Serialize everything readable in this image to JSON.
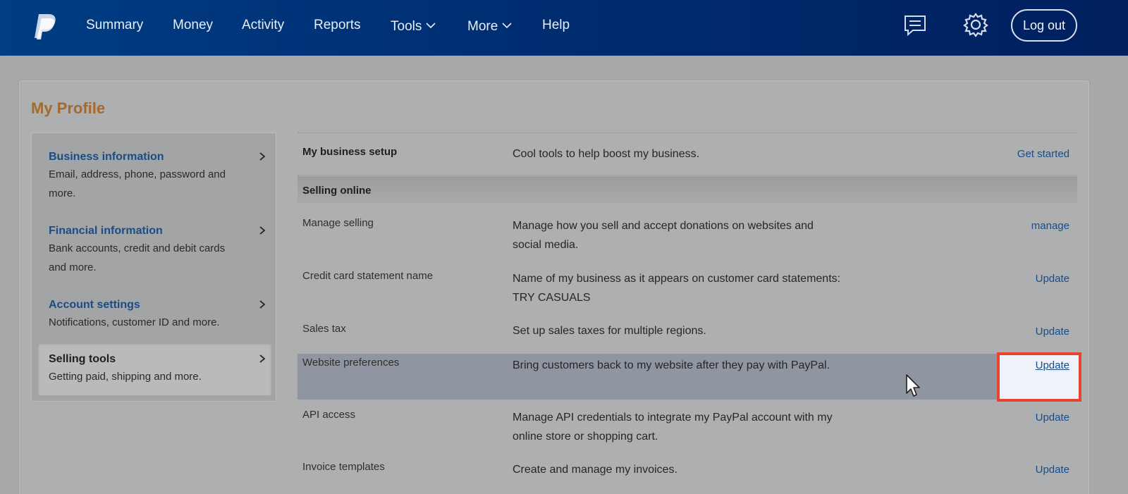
{
  "nav": {
    "items": [
      "Summary",
      "Money",
      "Activity",
      "Reports",
      "Tools",
      "More",
      "Help"
    ],
    "logout_label": "Log out"
  },
  "page": {
    "title": "My Profile"
  },
  "sidebar": {
    "items": [
      {
        "title": "Business information",
        "desc": "Email, address, phone, password and more."
      },
      {
        "title": "Financial information",
        "desc": "Bank accounts, credit and debit cards and more."
      },
      {
        "title": "Account settings",
        "desc": "Notifications, customer ID and more."
      },
      {
        "title": "Selling tools",
        "desc": "Getting paid, shipping and more."
      }
    ]
  },
  "main": {
    "setup": {
      "label": "My business setup",
      "desc": "Cool tools to help boost my business.",
      "action": "Get started"
    },
    "section_title": "Selling online",
    "rows": [
      {
        "label": "Manage selling",
        "desc": "Manage how you sell and accept donations on websites and social media.",
        "action": "manage"
      },
      {
        "label": "Credit card statement name",
        "desc": "Name of my business as it appears on customer card statements: TRY CASUALS",
        "action": "Update"
      },
      {
        "label": "Sales tax",
        "desc": "Set up sales taxes for multiple regions.",
        "action": "Update"
      },
      {
        "label": "Website preferences",
        "desc": "Bring customers back to my website after they pay with PayPal.",
        "action": "Update"
      },
      {
        "label": "API access",
        "desc": "Manage API credentials to integrate my PayPal account with my online store or shopping cart.",
        "action": "Update"
      },
      {
        "label": "Invoice templates",
        "desc": "Create and manage my invoices.",
        "action": "Update"
      }
    ]
  },
  "icons": {
    "logo": "paypal-logo",
    "messages": "message-icon",
    "settings": "gear-icon",
    "cursor": "mouse-cursor-icon"
  },
  "colors": {
    "nav_bg": "#003d84",
    "link": "#1a4c85",
    "title": "#a86a2c",
    "highlight": "#e8432e"
  }
}
